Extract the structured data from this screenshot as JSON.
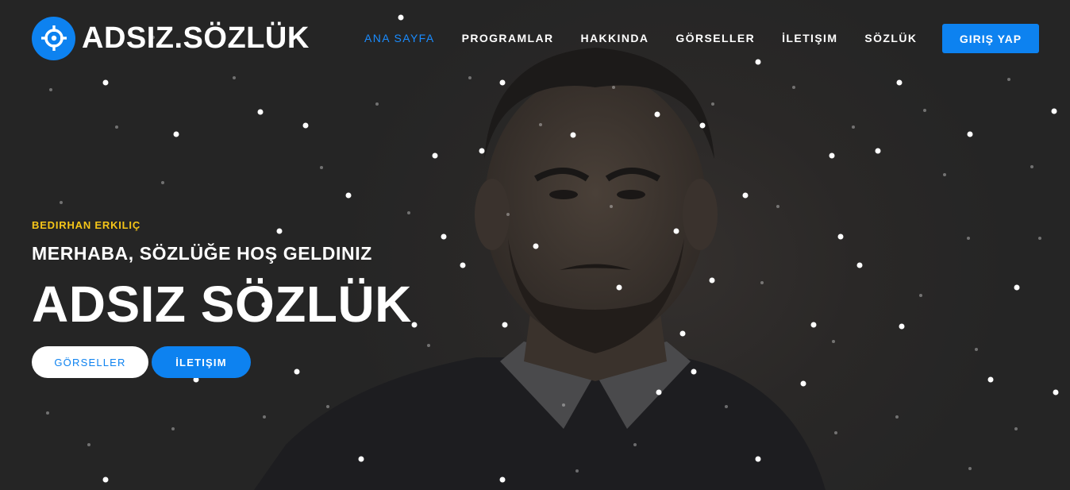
{
  "brand": {
    "name": "ADSIZ.SÖZLÜK",
    "icon": "crosshair-icon",
    "accent_color": "#0d82f0"
  },
  "nav": {
    "items": [
      {
        "label": "ANA SAYFA",
        "active": true
      },
      {
        "label": "PROGRAMLAR",
        "active": false
      },
      {
        "label": "HAKKINDA",
        "active": false
      },
      {
        "label": "GÖRSELLER",
        "active": false
      },
      {
        "label": "İLETIŞIM",
        "active": false
      },
      {
        "label": "SÖZLÜK",
        "active": false
      }
    ],
    "login_label": "GIRIŞ YAP"
  },
  "hero": {
    "eyebrow": "BEDIRHAN ERKILIÇ",
    "eyebrow_color": "#f5c518",
    "subheading": "MERHABA, SÖZLÜĞE HOŞ GELDINIZ",
    "headline": "ADSIZ SÖZLÜK",
    "buttons": {
      "secondary": "GÖRSELLER",
      "primary": "İLETIŞIM"
    }
  }
}
